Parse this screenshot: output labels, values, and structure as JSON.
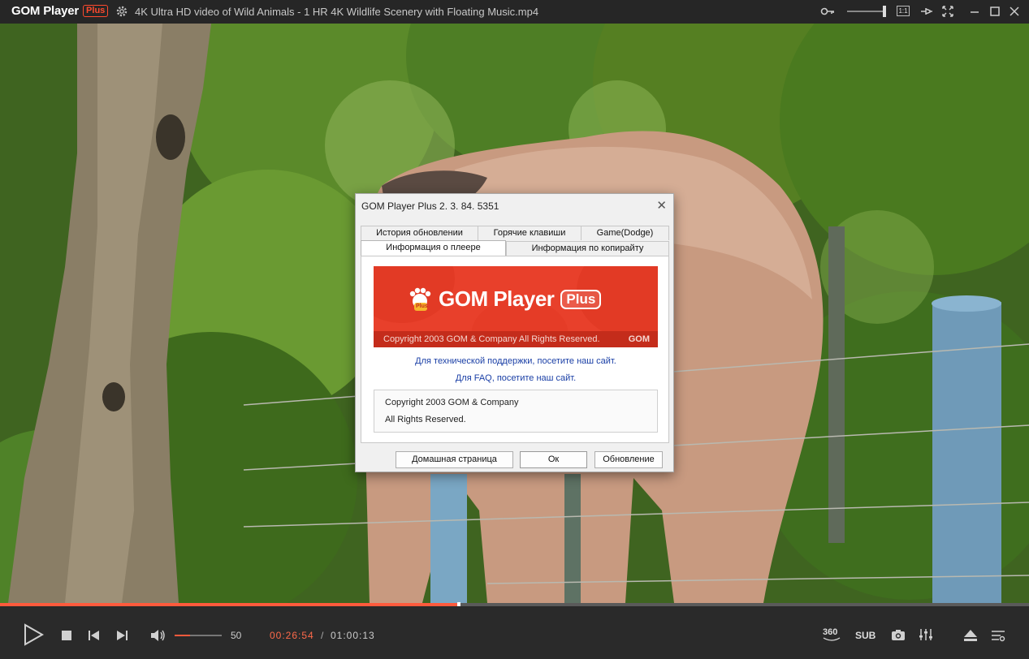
{
  "app": {
    "name": "GOM Player",
    "edition_badge": "Plus",
    "file_title": "4K Ultra HD video of Wild Animals - 1 HR 4K Wildlife Scenery with Floating Music.mp4",
    "ratio_label": "1:1"
  },
  "dialog": {
    "title": "GOM Player Plus 2. 3. 84. 5351",
    "close_glyph": "✕",
    "tabs_row1": [
      {
        "label": "История обновлении"
      },
      {
        "label": "Горячие клавиши"
      },
      {
        "label": "Game(Dodge)"
      }
    ],
    "tabs_row2": [
      {
        "label": "Информация о плеере",
        "active": true
      },
      {
        "label": "Информация по копирайту"
      }
    ],
    "banner": {
      "logo_text": "GOM Player",
      "logo_plus": "Plus",
      "paw_badge": "Plus",
      "copyright": "Copyright 2003 GOM & Company All Rights Reserved.",
      "corner_brand": "GOM"
    },
    "links": {
      "support": "Для технической поддержки, посетите наш сайт.",
      "faq": "Для FAQ, посетите наш сайт."
    },
    "copyright_box": {
      "line1": "Copyright 2003 GOM & Company",
      "line2": "All Rights Reserved."
    },
    "buttons": {
      "homepage": "Домашная страница",
      "ok": "Ок",
      "update": "Обновление"
    }
  },
  "playback": {
    "progress_fraction": 0.446,
    "volume": "50",
    "volume_fraction": 0.33,
    "time_current": "00:26:54",
    "time_separator": "/",
    "time_total": "01:00:13"
  },
  "controls": {
    "label_360": "360",
    "label_sub": "SUB"
  },
  "colors": {
    "accent": "#ff5a3c",
    "banner_red": "#e8402b",
    "titlebar": "#262626",
    "controlbar": "#2a2a2a"
  }
}
